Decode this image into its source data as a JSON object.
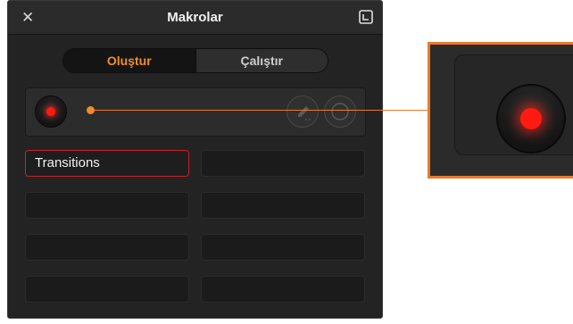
{
  "window": {
    "title": "Makrolar",
    "close_icon": "close-icon",
    "popout_icon": "popout-icon"
  },
  "tabs": [
    {
      "label": "Oluştur",
      "active": true
    },
    {
      "label": "Çalıştır",
      "active": false
    }
  ],
  "record_bar": {
    "record_icon": "record-icon",
    "edit_icon": "edit-icon",
    "stop_icon": "stop-icon"
  },
  "macros": [
    {
      "label": "Transitions",
      "selected": true
    },
    {
      "label": ""
    },
    {
      "label": ""
    },
    {
      "label": ""
    },
    {
      "label": ""
    },
    {
      "label": ""
    },
    {
      "label": ""
    },
    {
      "label": ""
    }
  ],
  "colors": {
    "accent_orange": "#f0902a",
    "record_red": "#ff1a12",
    "selected_border": "#c8202a",
    "callout": "#e87a2a",
    "panel_bg": "#232323"
  }
}
